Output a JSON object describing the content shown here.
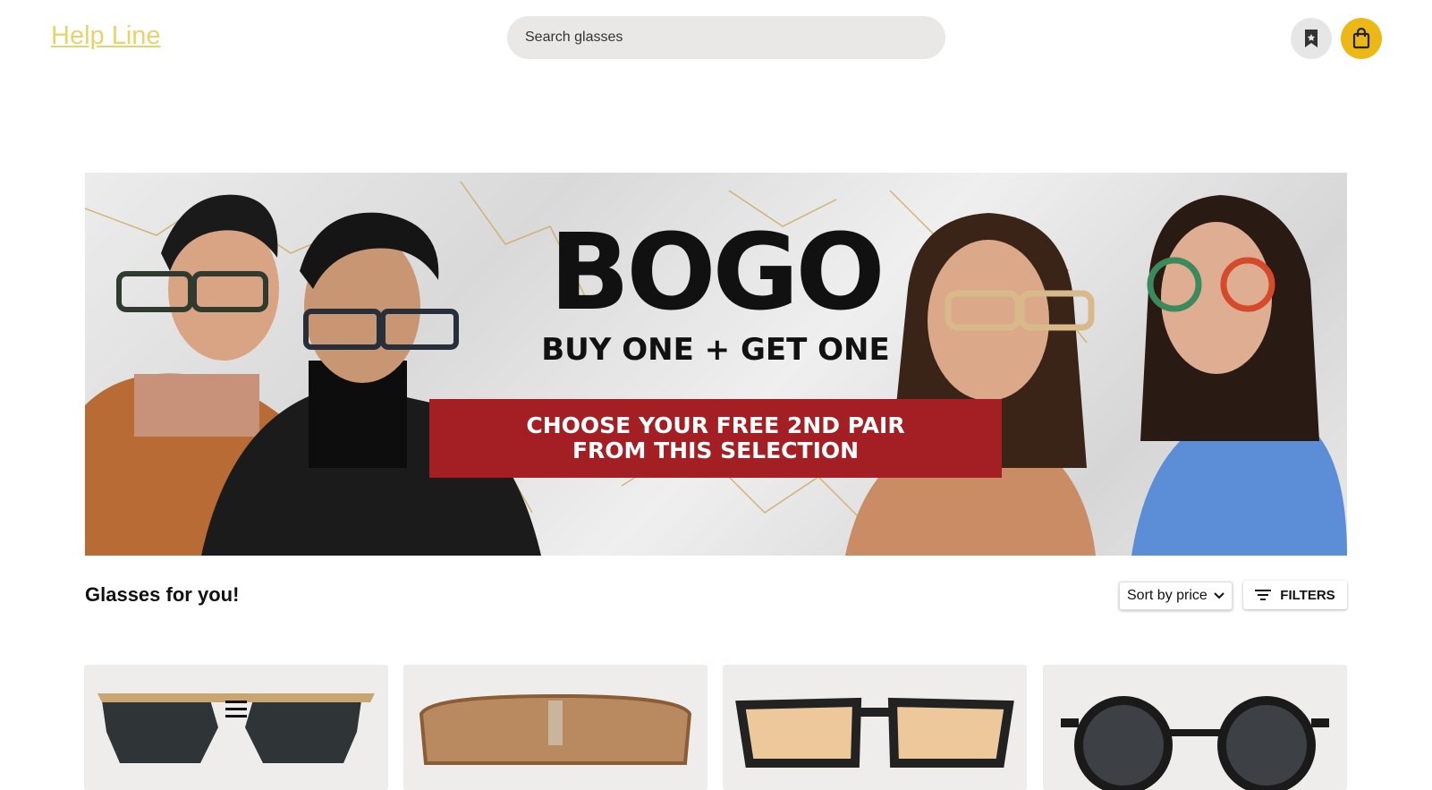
{
  "header": {
    "help_line": "Help Line",
    "search_placeholder": "Search glasses",
    "bookmark_icon": "bookmark-icon",
    "cart_icon": "shopping-bag-icon"
  },
  "banner": {
    "title": "BOGO",
    "subtitle": "BUY ONE + GET ONE",
    "strip_line1": "CHOOSE YOUR FREE 2ND PAIR",
    "strip_line2": "FROM THIS SELECTION"
  },
  "products_section": {
    "title": "Glasses for you!",
    "sort_label": "Sort by price",
    "filters_label": "FILTERS"
  },
  "colors": {
    "accent_yellow": "#ecb815",
    "help_line": "#e8d26a",
    "banner_red": "#a41f24"
  }
}
